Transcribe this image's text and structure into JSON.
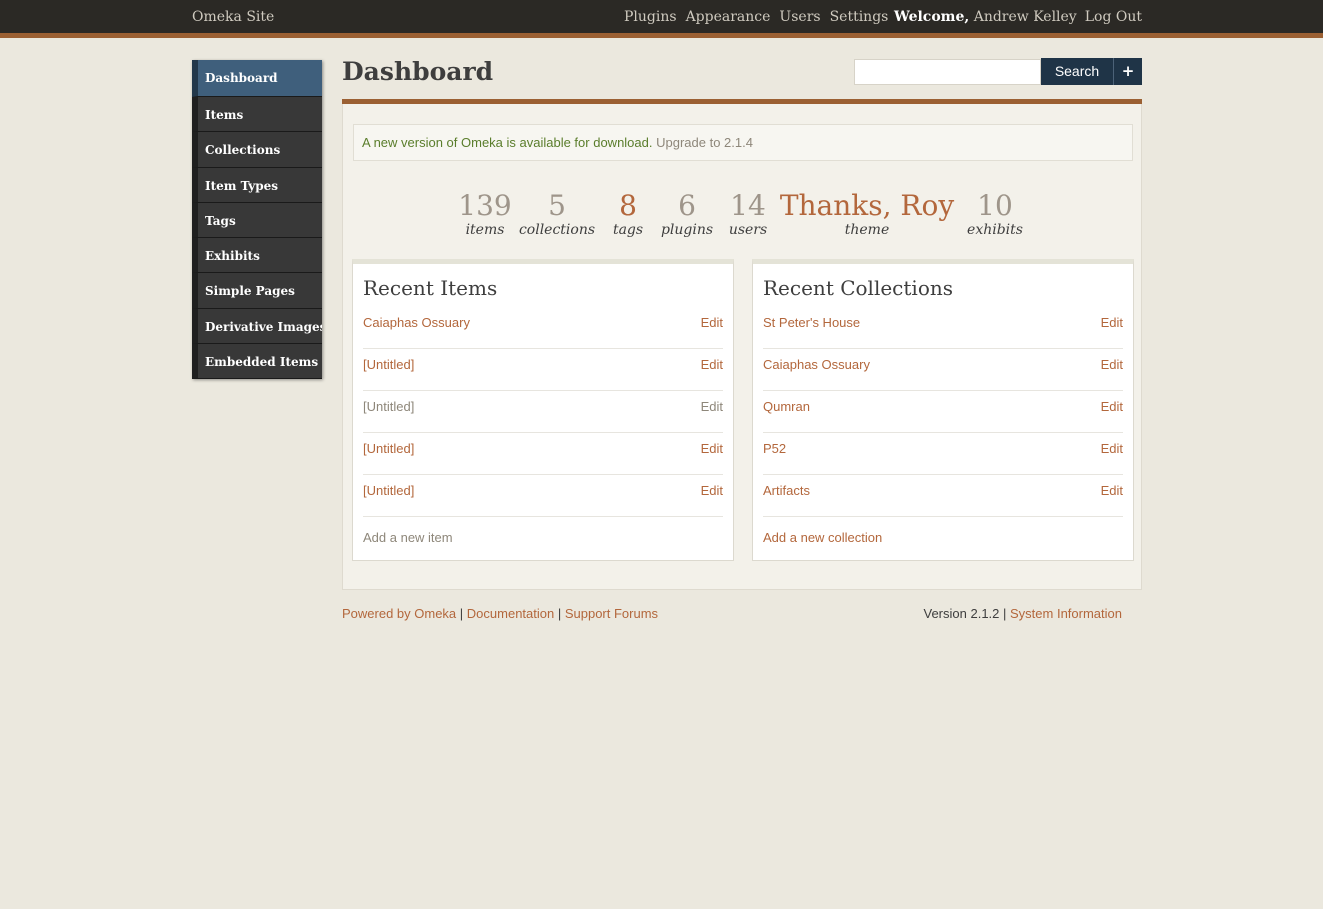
{
  "header": {
    "site_title": "Omeka Site",
    "nav": [
      "Plugins",
      "Appearance",
      "Users",
      "Settings"
    ],
    "welcome_label": "Welcome,",
    "user_name": "Andrew Kelley",
    "logout_label": "Log Out"
  },
  "sidebar": {
    "items": [
      {
        "label": "Dashboard",
        "active": true
      },
      {
        "label": "Items"
      },
      {
        "label": "Collections"
      },
      {
        "label": "Item Types"
      },
      {
        "label": "Tags"
      },
      {
        "label": "Exhibits"
      },
      {
        "label": "Simple Pages"
      },
      {
        "label": "Derivative Images"
      },
      {
        "label": "Embedded Items"
      }
    ]
  },
  "page": {
    "title": "Dashboard",
    "search_value": "",
    "search_label": "Search",
    "plus_label": "+"
  },
  "alert": {
    "message": "A new version of Omeka is available for download.",
    "upgrade_label": "Upgrade to 2.1.4"
  },
  "stats": [
    {
      "value": "139",
      "label": "items"
    },
    {
      "value": "5",
      "label": "collections"
    },
    {
      "value": "8",
      "label": "tags",
      "accent": true
    },
    {
      "value": "6",
      "label": "plugins"
    },
    {
      "value": "14",
      "label": "users"
    },
    {
      "value": "Thanks, Roy",
      "label": "theme",
      "accent": true
    },
    {
      "value": "10",
      "label": "exhibits"
    }
  ],
  "recent_items": {
    "title": "Recent Items",
    "rows": [
      {
        "name": "Caiaphas Ossuary",
        "edit": "Edit",
        "muted": false
      },
      {
        "name": "[Untitled]",
        "edit": "Edit",
        "muted": false
      },
      {
        "name": "[Untitled]",
        "edit": "Edit",
        "muted": true
      },
      {
        "name": "[Untitled]",
        "edit": "Edit",
        "muted": false
      },
      {
        "name": "[Untitled]",
        "edit": "Edit",
        "muted": false
      }
    ],
    "add_label": "Add a new item"
  },
  "recent_collections": {
    "title": "Recent Collections",
    "rows": [
      {
        "name": "St Peter's House",
        "edit": "Edit"
      },
      {
        "name": "Caiaphas Ossuary",
        "edit": "Edit"
      },
      {
        "name": "Qumran",
        "edit": "Edit"
      },
      {
        "name": "P52",
        "edit": "Edit"
      },
      {
        "name": "Artifacts",
        "edit": "Edit"
      }
    ],
    "add_label": "Add a new collection"
  },
  "footer": {
    "powered_by": "Powered by Omeka",
    "documentation": "Documentation",
    "support_forums": "Support Forums",
    "version": "Version 2.1.2",
    "system_info": "System Information"
  },
  "colors": {
    "accent": "#b3673c",
    "topbar": "#2b2925",
    "rule": "#9b6033",
    "active_nav": "#3f5f7c",
    "search_button": "#1f3447"
  }
}
